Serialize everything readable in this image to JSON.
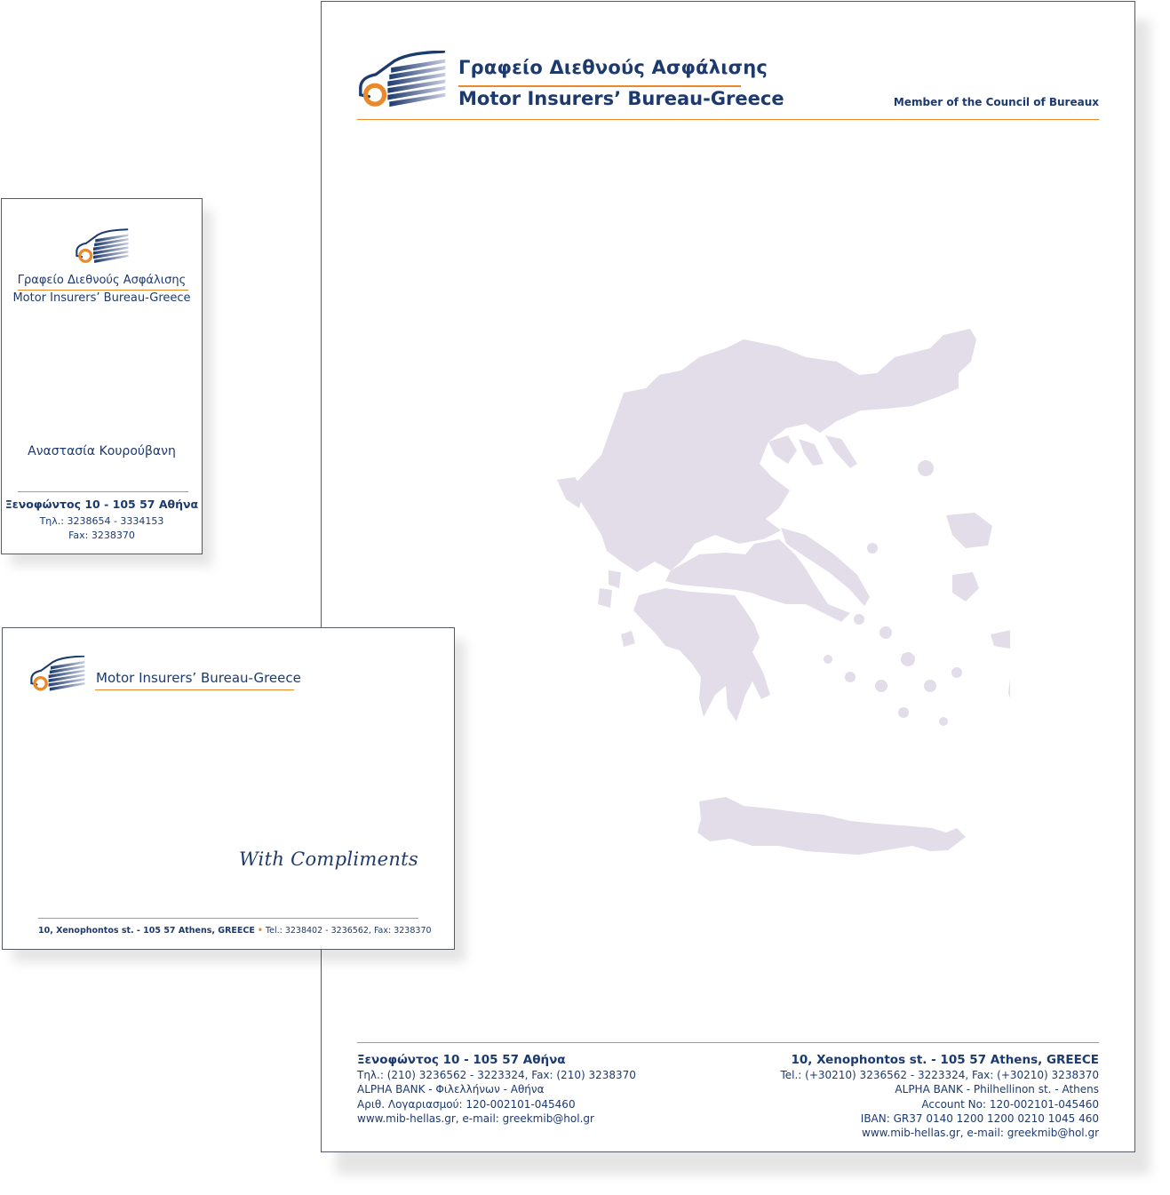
{
  "colors": {
    "navy": "#1d3a6e",
    "orange": "#e8892a",
    "map_fill": "#e2dde8"
  },
  "letterhead": {
    "title_greek": "Γραφείο Διεθνούς Ασφάλισης",
    "title_english": "Motor Insurers’ Bureau-Greece",
    "member_text": "Member of the Council of Bureaux",
    "footer_left": {
      "address": "Ξενοφώντος 10 - 105 57 Αθήνα",
      "phone": "Τηλ.: (210) 3236562 - 3223324, Fax: (210) 3238370",
      "bank": "ALPHA BANK - Φιλελλήνων - Αθήνα",
      "account": "Αριθ. Λογαριασμού: 120-002101-045460",
      "web": "www.mib-hellas.gr, e-mail: greekmib@hol.gr"
    },
    "footer_right": {
      "address": "10, Xenophontos st. - 105 57 Athens, GREECE",
      "phone": "Tel.: (+30210) 3236562 - 3223324, Fax: (+30210) 3238370",
      "bank": "ALPHA BANK - Philhellinon st. - Athens",
      "account": "Account No: 120-002101-045460",
      "iban": "IBAN: GR37 0140 1200 1200 0210 1045 460",
      "web": "www.mib-hellas.gr, e-mail: greekmib@hol.gr"
    },
    "map_icon": "greece-map-silhouette"
  },
  "business_card": {
    "title_greek": "Γραφείο Διεθνούς Ασφάλισης",
    "title_english": "Motor Insurers’ Bureau-Greece",
    "name": "Αναστασία Κουρούβανη",
    "address": "Ξενοφώντος 10 - 105 57 Αθήνα",
    "phone": "Τηλ.: 3238654 - 3334153",
    "fax": "Fax: 3238370"
  },
  "compliments_slip": {
    "title": "Motor Insurers’ Bureau-Greece",
    "compliments": "With Compliments",
    "address_bold": "10, Xenophontos st. - 105 57 Athens, GREECE",
    "separator": "•",
    "contact": "Tel.: 3238402 - 3236562, Fax: 3238370"
  },
  "logo_icon": "car-wheel-logo-icon"
}
